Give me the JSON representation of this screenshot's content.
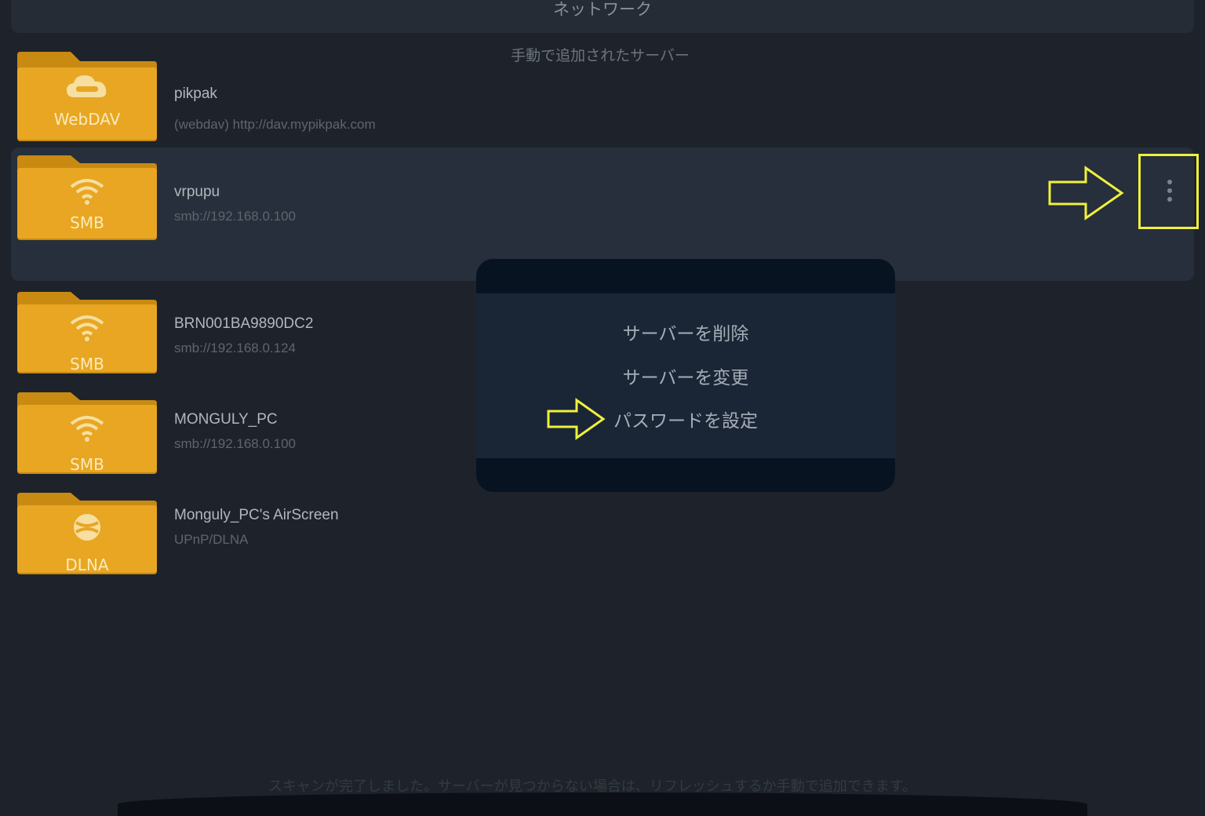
{
  "header": {
    "title": "ネットワーク"
  },
  "section": {
    "title": "手動で追加されたサーバー"
  },
  "servers": [
    {
      "name": "pikpak",
      "address": "(webdav) http://dav.mypikpak.com",
      "type_label": "WebDAV",
      "icon": "cloud-icon"
    },
    {
      "name": "vrpupu",
      "address": "smb://192.168.0.100",
      "type_label": "SMB",
      "icon": "wifi-icon"
    },
    {
      "name": "BRN001BA9890DC2",
      "address": "smb://192.168.0.124",
      "type_label": "SMB",
      "icon": "wifi-icon"
    },
    {
      "name": "MONGULY_PC",
      "address": "smb://192.168.0.100",
      "type_label": "SMB",
      "icon": "wifi-icon"
    },
    {
      "name": "Monguly_PC's AirScreen",
      "address": "UPnP/DLNA",
      "type_label": "DLNA",
      "icon": "globe-icon"
    }
  ],
  "context_menu": {
    "items": [
      "サーバーを削除",
      "サーバーを変更",
      "パスワードを設定"
    ]
  },
  "footer": {
    "status": "スキャンが完了しました。サーバーが見つからない場合は、リフレッシュするか手動で追加できます。"
  },
  "colors": {
    "folder": "#e8a623",
    "folder_dark": "#c98a12",
    "highlight": "#f0f03c",
    "background": "#1e232b",
    "menu": "#1a2636"
  }
}
